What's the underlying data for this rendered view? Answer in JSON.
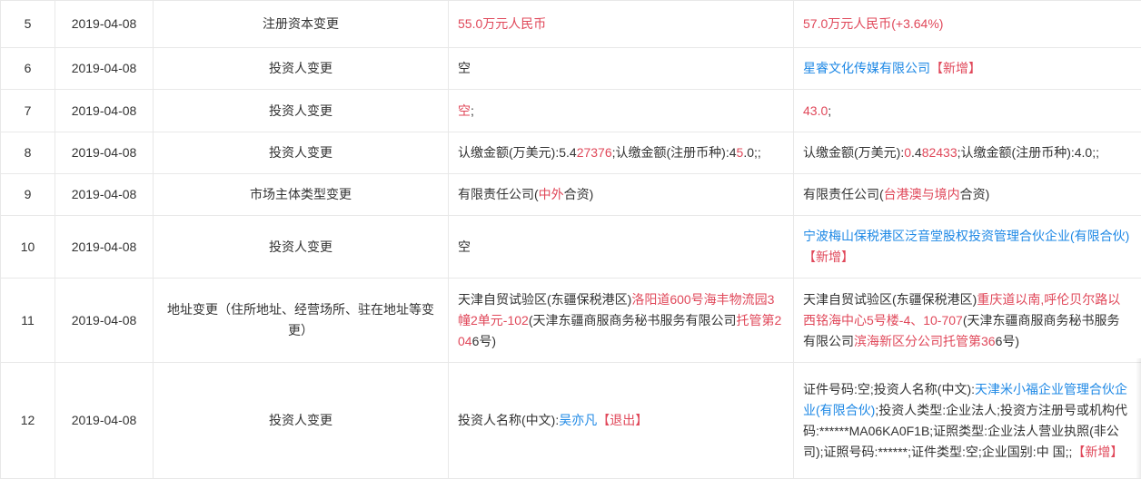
{
  "rows": [
    {
      "idx": "5",
      "date": "2019-04-08",
      "item": "注册资本变更",
      "before": [
        {
          "t": "55.0万元人民币",
          "c": "red"
        }
      ],
      "after": [
        {
          "t": "57.0万元人民币(+3.64%)",
          "c": "red"
        }
      ]
    },
    {
      "idx": "6",
      "date": "2019-04-08",
      "item": "投资人变更",
      "before": [
        {
          "t": "空"
        }
      ],
      "after": [
        {
          "t": "星睿文化传媒有限公司",
          "c": "blue-link"
        },
        {
          "t": "【新增】",
          "c": "red"
        }
      ]
    },
    {
      "idx": "7",
      "date": "2019-04-08",
      "item": "投资人变更",
      "before": [
        {
          "t": "空",
          "c": "red"
        },
        {
          "t": ";"
        }
      ],
      "after": [
        {
          "t": "43.0",
          "c": "red"
        },
        {
          "t": ";"
        }
      ]
    },
    {
      "idx": "8",
      "date": "2019-04-08",
      "item": "投资人变更",
      "before": [
        {
          "t": "认缴金额(万美元):"
        },
        {
          "t": "5.4"
        },
        {
          "t": "27376",
          "c": "red"
        },
        {
          "t": ";认缴金额(注册币种):4"
        },
        {
          "t": "5",
          "c": "red"
        },
        {
          "t": ".0;;"
        }
      ],
      "after": [
        {
          "t": "认缴金额(万美元):"
        },
        {
          "t": "0",
          "c": "red"
        },
        {
          "t": ".4"
        },
        {
          "t": "82433",
          "c": "red"
        },
        {
          "t": ";认缴金额(注册币种):4.0;;"
        }
      ]
    },
    {
      "idx": "9",
      "date": "2019-04-08",
      "item": "市场主体类型变更",
      "before": [
        {
          "t": "有限责任公司("
        },
        {
          "t": "中外",
          "c": "red"
        },
        {
          "t": "合资)"
        }
      ],
      "after": [
        {
          "t": "有限责任公司("
        },
        {
          "t": "台港澳与境内",
          "c": "red"
        },
        {
          "t": "合资)"
        }
      ]
    },
    {
      "idx": "10",
      "date": "2019-04-08",
      "item": "投资人变更",
      "before": [
        {
          "t": "空"
        }
      ],
      "after": [
        {
          "t": "宁波梅山保税港区泛音堂股权投资管理合伙企业(有限合伙)",
          "c": "blue-link"
        },
        {
          "t": "【新增】",
          "c": "red"
        }
      ]
    },
    {
      "idx": "11",
      "date": "2019-04-08",
      "item": "地址变更（住所地址、经营场所、驻在地址等变更）",
      "before": [
        {
          "t": "天津自贸试验区(东疆保税港区)"
        },
        {
          "t": "洛阳道600号海丰物流园3幢2单元-102",
          "c": "red"
        },
        {
          "t": "(天津东疆商服商务秘书服务有限公司"
        },
        {
          "t": "托管第204",
          "c": "red"
        },
        {
          "t": "6号)"
        }
      ],
      "after": [
        {
          "t": "天津自贸试验区(东疆保税港区)"
        },
        {
          "t": "重庆道以南,呼伦贝尔路以西铭海中心5号楼-4、10-707",
          "c": "red"
        },
        {
          "t": "(天津东疆商服商务秘书服务有限公司"
        },
        {
          "t": "滨海新区分公司托管第36",
          "c": "red"
        },
        {
          "t": "6号)"
        }
      ]
    },
    {
      "idx": "12",
      "date": "2019-04-08",
      "item": "投资人变更",
      "before": [
        {
          "t": "投资人名称(中文):"
        },
        {
          "t": "吴亦凡",
          "c": "blue-link"
        },
        {
          "t": "【退出】",
          "c": "red"
        }
      ],
      "after": [
        {
          "t": "证件号码:空;投资人名称(中文):"
        },
        {
          "t": "天津米小福企业管理合伙企业(有限合伙)",
          "c": "blue-link"
        },
        {
          "t": ";投资人类型:企业法人;投资方注册号或机构代码:******MA06KA0F1B;证照类型:企业法人营业执照(非公司);证照号码:******;证件类型:空;企业国别:中 国;;"
        },
        {
          "t": "【新增】",
          "c": "red"
        }
      ]
    }
  ]
}
